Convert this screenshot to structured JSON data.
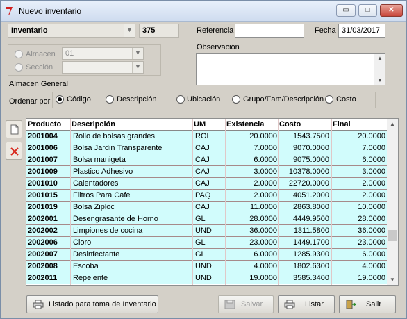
{
  "window": {
    "title": "Nuevo inventario",
    "controls": [
      "▭",
      "□",
      "✕"
    ]
  },
  "header": {
    "type_select": "Inventario",
    "number": "375",
    "referencia_label": "Referencia",
    "referencia_value": "",
    "fecha_label": "Fecha",
    "fecha_value": "31/03/2017",
    "observacion_label": "Observación"
  },
  "location": {
    "almacen_label": "Almacén",
    "almacen_value": "01",
    "seccion_label": "Sección",
    "seccion_value": "",
    "almacen_general": "Almacen General"
  },
  "sort": {
    "label": "Ordenar por",
    "options": [
      "Código",
      "Descripción",
      "Ubicación",
      "Grupo/Fam/Descripción",
      "Costo"
    ],
    "selected": "Código"
  },
  "grid": {
    "columns": [
      "Producto",
      "Descripción",
      "UM",
      "Existencia",
      "Costo",
      "Final"
    ],
    "rows": [
      [
        "2001004",
        "Rollo de bolsas grandes",
        "ROL",
        "20.0000",
        "1543.7500",
        "20.0000"
      ],
      [
        "2001006",
        "Bolsa Jardin Transparente",
        "CAJ",
        "7.0000",
        "9070.0000",
        "7.0000"
      ],
      [
        "2001007",
        "Bolsa manigeta",
        "CAJ",
        "6.0000",
        "9075.0000",
        "6.0000"
      ],
      [
        "2001009",
        "Plastico Adhesivo",
        "CAJ",
        "3.0000",
        "10378.0000",
        "3.0000"
      ],
      [
        "2001010",
        "Calentadores",
        "CAJ",
        "2.0000",
        "22720.0000",
        "2.0000"
      ],
      [
        "2001015",
        "Filtros Para Cafe",
        "PAQ",
        "2.0000",
        "4051.2000",
        "2.0000"
      ],
      [
        "2001019",
        "Bolsa Ziploc",
        "CAJ",
        "11.0000",
        "2863.8000",
        "10.0000"
      ],
      [
        "2002001",
        "Desengrasante de Horno",
        "GL",
        "28.0000",
        "4449.9500",
        "28.0000"
      ],
      [
        "2002002",
        "Limpiones de cocina",
        "UND",
        "36.0000",
        "1311.5800",
        "36.0000"
      ],
      [
        "2002006",
        "Cloro",
        "GL",
        "23.0000",
        "1449.1700",
        "23.0000"
      ],
      [
        "2002007",
        "Desinfectante",
        "GL",
        "6.0000",
        "1285.9300",
        "6.0000"
      ],
      [
        "2002008",
        "Escoba",
        "UND",
        "4.0000",
        "1802.6300",
        "4.0000"
      ],
      [
        "2002011",
        "Repelente",
        "UND",
        "19.0000",
        "3585.3400",
        "19.0000"
      ]
    ]
  },
  "buttons": {
    "listado": "Listado para toma de Inventario",
    "salvar": "Salvar",
    "listar": "Listar",
    "salir": "Salir"
  },
  "colors": {
    "row_bg": "#d1fcfc",
    "row_border": "#a68a8a",
    "window_bg": "#d4d0c8",
    "close_red": "#c8463a"
  }
}
